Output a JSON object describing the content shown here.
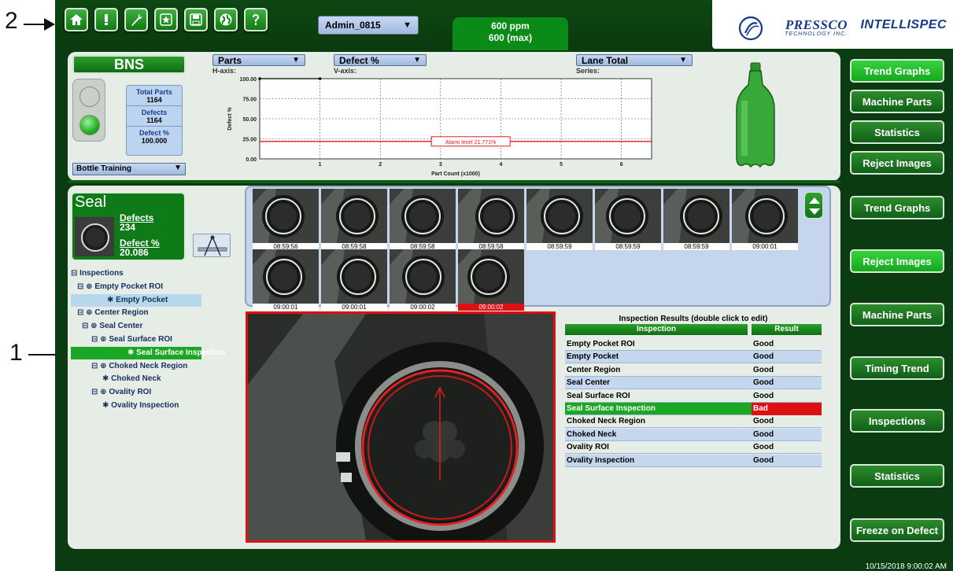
{
  "callouts": {
    "one": "1",
    "two": "2"
  },
  "toolbar": {
    "buttons": [
      "home-icon",
      "alert-icon",
      "wrench-icon",
      "star-icon",
      "save-icon",
      "globe-icon",
      "help-icon"
    ],
    "user": "Admin_0815",
    "speed_line1": "600 ppm",
    "speed_line2": "600 (max)"
  },
  "brand": {
    "pressco": "PRESSCO",
    "pressco_sub": "TECHNOLOGY INC.",
    "intellispec": "INTELLISPEC"
  },
  "bns": {
    "title": "BNS",
    "total_parts_label": "Total Parts",
    "total_parts": "1164",
    "defects_label": "Defects",
    "defects": "1164",
    "defect_pct_label": "Defect %",
    "defect_pct": "100.000",
    "training_select": "Bottle Training"
  },
  "axis_selectors": {
    "h_axis_value": "Parts",
    "h_axis_caption": "H-axis:",
    "v_axis_value": "Defect %",
    "v_axis_caption": "V-axis:",
    "series_value": "Lane Total",
    "series_caption": "Series:"
  },
  "chart_data": {
    "type": "line",
    "x": [
      0,
      1
    ],
    "y": [
      100,
      100
    ],
    "xlabel": "Part Count (x1000)",
    "ylabel": "Defect %",
    "xticks": [
      "1",
      "2",
      "3",
      "4",
      "5",
      "6"
    ],
    "yticks": [
      "0.00",
      "25.00",
      "50.00",
      "75.00",
      "100.00"
    ],
    "xlim": [
      0,
      6.5
    ],
    "ylim": [
      0,
      100
    ],
    "alarm_level": 21.771,
    "alarm_label": "Alarm level 21.771%",
    "grid": true,
    "colors": {
      "series": "#000000",
      "alarm": "#e41b1b"
    }
  },
  "right_menu_top": [
    {
      "label": "Trend Graphs",
      "active": true
    },
    {
      "label": "Machine Parts",
      "active": false
    },
    {
      "label": "Statistics",
      "active": false
    },
    {
      "label": "Reject Images",
      "active": false
    }
  ],
  "right_menu_bottom": [
    {
      "label": "Trend Graphs",
      "active": false
    },
    {
      "label": "Reject Images",
      "active": true
    },
    {
      "label": "Machine Parts",
      "active": false
    },
    {
      "label": "Timing Trend",
      "active": false
    },
    {
      "label": "Inspections",
      "active": false
    },
    {
      "label": "Statistics",
      "active": false
    },
    {
      "label": "Freeze on Defect",
      "active": false
    }
  ],
  "seal": {
    "title": "Seal",
    "defects_label": "Defects",
    "defects": "234",
    "defect_pct_label": "Defect %",
    "defect_pct": "20.086"
  },
  "tree": [
    {
      "label": "Inspections",
      "prefix": "⊟",
      "level": 0,
      "state": ""
    },
    {
      "label": "Empty Pocket ROI",
      "prefix": "⊟ ⊕",
      "level": 1,
      "state": ""
    },
    {
      "label": "Empty Pocket",
      "prefix": "✱",
      "level": 2,
      "state": "hl"
    },
    {
      "label": "Center Region",
      "prefix": "⊟ ⊕",
      "level": 1,
      "state": ""
    },
    {
      "label": "Seal Center",
      "prefix": "⊟ ⊕",
      "level": 2,
      "state": ""
    },
    {
      "label": "Seal Surface ROI",
      "prefix": "⊟ ⊕",
      "level": 3,
      "state": ""
    },
    {
      "label": "Seal Surface Inspection",
      "prefix": "✱",
      "level": 4,
      "state": "sel"
    },
    {
      "label": "Choked Neck Region",
      "prefix": "⊟ ⊕",
      "level": 3,
      "state": ""
    },
    {
      "label": "Choked Neck",
      "prefix": "✱",
      "level": 4,
      "state": ""
    },
    {
      "label": "Ovality ROI",
      "prefix": "⊟ ⊕",
      "level": 3,
      "state": ""
    },
    {
      "label": "Ovality Inspection",
      "prefix": "✱",
      "level": 4,
      "state": ""
    }
  ],
  "thumbnails": [
    {
      "time": "08:59:56",
      "bad": false
    },
    {
      "time": "08:59:58",
      "bad": false
    },
    {
      "time": "08:59:58",
      "bad": false
    },
    {
      "time": "08:59:58",
      "bad": false
    },
    {
      "time": "08:59:59",
      "bad": false
    },
    {
      "time": "08:59:59",
      "bad": false
    },
    {
      "time": "08:59:59",
      "bad": false
    },
    {
      "time": "09:00:01",
      "bad": false
    },
    {
      "time": "09:00:01",
      "bad": false
    },
    {
      "time": "09:00:01",
      "bad": false
    },
    {
      "time": "09:00:02",
      "bad": false
    },
    {
      "time": "09:00:02",
      "bad": true
    }
  ],
  "results": {
    "title": "Inspection Results (double click to edit)",
    "col_inspection": "Inspection",
    "col_result": "Result",
    "rows": [
      {
        "inspection": "Empty Pocket ROI",
        "result": "Good",
        "bad": false
      },
      {
        "inspection": "Empty Pocket",
        "result": "Good",
        "bad": false
      },
      {
        "inspection": "Center Region",
        "result": "Good",
        "bad": false
      },
      {
        "inspection": "Seal Center",
        "result": "Good",
        "bad": false
      },
      {
        "inspection": "Seal Surface ROI",
        "result": "Good",
        "bad": false
      },
      {
        "inspection": "Seal Surface Inspection",
        "result": "Bad",
        "bad": true
      },
      {
        "inspection": "Choked Neck Region",
        "result": "Good",
        "bad": false
      },
      {
        "inspection": "Choked Neck",
        "result": "Good",
        "bad": false
      },
      {
        "inspection": "Ovality ROI",
        "result": "Good",
        "bad": false
      },
      {
        "inspection": "Ovality Inspection",
        "result": "Good",
        "bad": false
      }
    ]
  },
  "footer": {
    "timestamp": "10/15/2018 9:00:02 AM"
  }
}
